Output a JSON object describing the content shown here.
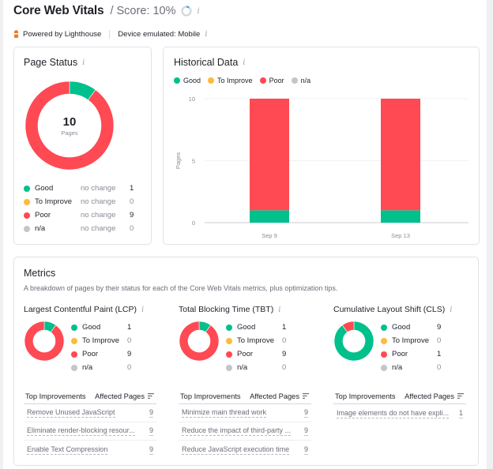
{
  "header": {
    "title": "Core Web Vitals",
    "score_label": "/ Score: 10%",
    "score_value": 10,
    "info_icon": "info-icon"
  },
  "subheader": {
    "powered_by": "Powered by Lighthouse",
    "device": "Device emulated: Mobile"
  },
  "colors": {
    "good": "#00c08b",
    "to_improve": "#fdbb3c",
    "poor": "#ff4953",
    "na": "#c4c5cb",
    "score_ring": "#2bb3e9"
  },
  "page_status": {
    "title": "Page Status",
    "total": "10",
    "total_label": "Pages",
    "rows": [
      {
        "label": "Good",
        "change": "no change",
        "value": "1",
        "key": "good"
      },
      {
        "label": "To Improve",
        "change": "no change",
        "value": "0",
        "key": "to_improve"
      },
      {
        "label": "Poor",
        "change": "no change",
        "value": "9",
        "key": "poor"
      },
      {
        "label": "n/a",
        "change": "no change",
        "value": "0",
        "key": "na"
      }
    ]
  },
  "historical": {
    "title": "Historical Data",
    "legend": [
      "Good",
      "To Improve",
      "Poor",
      "n/a"
    ]
  },
  "chart_data": [
    {
      "type": "pie",
      "title": "Page Status",
      "center_label": "10 Pages",
      "categories": [
        "Good",
        "To Improve",
        "Poor",
        "n/a"
      ],
      "values": [
        1,
        0,
        9,
        0
      ]
    },
    {
      "type": "bar",
      "stacked": true,
      "title": "Historical Data",
      "categories": [
        "Sep 9",
        "Sep 13"
      ],
      "series": [
        {
          "name": "Good",
          "values": [
            1,
            1
          ]
        },
        {
          "name": "To Improve",
          "values": [
            0,
            0
          ]
        },
        {
          "name": "Poor",
          "values": [
            9,
            9
          ]
        },
        {
          "name": "n/a",
          "values": [
            0,
            0
          ]
        }
      ],
      "xlabel": "",
      "ylabel": "Pages",
      "ylim": [
        0,
        10
      ],
      "yticks": [
        0,
        5,
        10
      ],
      "grid": true,
      "legend": "top-left"
    },
    {
      "type": "pie",
      "title": "Largest Contentful Paint (LCP)",
      "categories": [
        "Good",
        "To Improve",
        "Poor",
        "n/a"
      ],
      "values": [
        1,
        0,
        9,
        0
      ]
    },
    {
      "type": "pie",
      "title": "Total Blocking Time (TBT)",
      "categories": [
        "Good",
        "To Improve",
        "Poor",
        "n/a"
      ],
      "values": [
        1,
        0,
        9,
        0
      ]
    },
    {
      "type": "pie",
      "title": "Cumulative Layout Shift (CLS)",
      "categories": [
        "Good",
        "To Improve",
        "Poor",
        "n/a"
      ],
      "values": [
        9,
        0,
        1,
        0
      ]
    }
  ],
  "metrics": {
    "title": "Metrics",
    "description": "A breakdown of pages by their status for each of the Core Web Vitals metrics, plus optimization tips.",
    "table_header": {
      "left": "Top Improvements",
      "right": "Affected Pages"
    },
    "items": [
      {
        "title": "Largest Contentful Paint (LCP)",
        "legend": [
          {
            "label": "Good",
            "value": "1"
          },
          {
            "label": "To Improve",
            "value": "0"
          },
          {
            "label": "Poor",
            "value": "9"
          },
          {
            "label": "n/a",
            "value": "0"
          }
        ],
        "improvements": [
          {
            "name": "Remove Unused JavaScript",
            "count": "9"
          },
          {
            "name": "Eliminate render-blocking resour...",
            "count": "9"
          },
          {
            "name": "Enable Text Compression",
            "count": "9"
          }
        ]
      },
      {
        "title": "Total Blocking Time (TBT)",
        "legend": [
          {
            "label": "Good",
            "value": "1"
          },
          {
            "label": "To Improve",
            "value": "0"
          },
          {
            "label": "Poor",
            "value": "9"
          },
          {
            "label": "n/a",
            "value": "0"
          }
        ],
        "improvements": [
          {
            "name": "Minimize main thread work",
            "count": "9"
          },
          {
            "name": "Reduce the impact of third-party ...",
            "count": "9"
          },
          {
            "name": "Reduce JavaScript execution time",
            "count": "9"
          }
        ]
      },
      {
        "title": "Cumulative Layout Shift (CLS)",
        "legend": [
          {
            "label": "Good",
            "value": "9"
          },
          {
            "label": "To Improve",
            "value": "0"
          },
          {
            "label": "Poor",
            "value": "1"
          },
          {
            "label": "n/a",
            "value": "0"
          }
        ],
        "improvements": [
          {
            "name": "Image elements do not have expli...",
            "count": "1"
          }
        ]
      }
    ]
  }
}
